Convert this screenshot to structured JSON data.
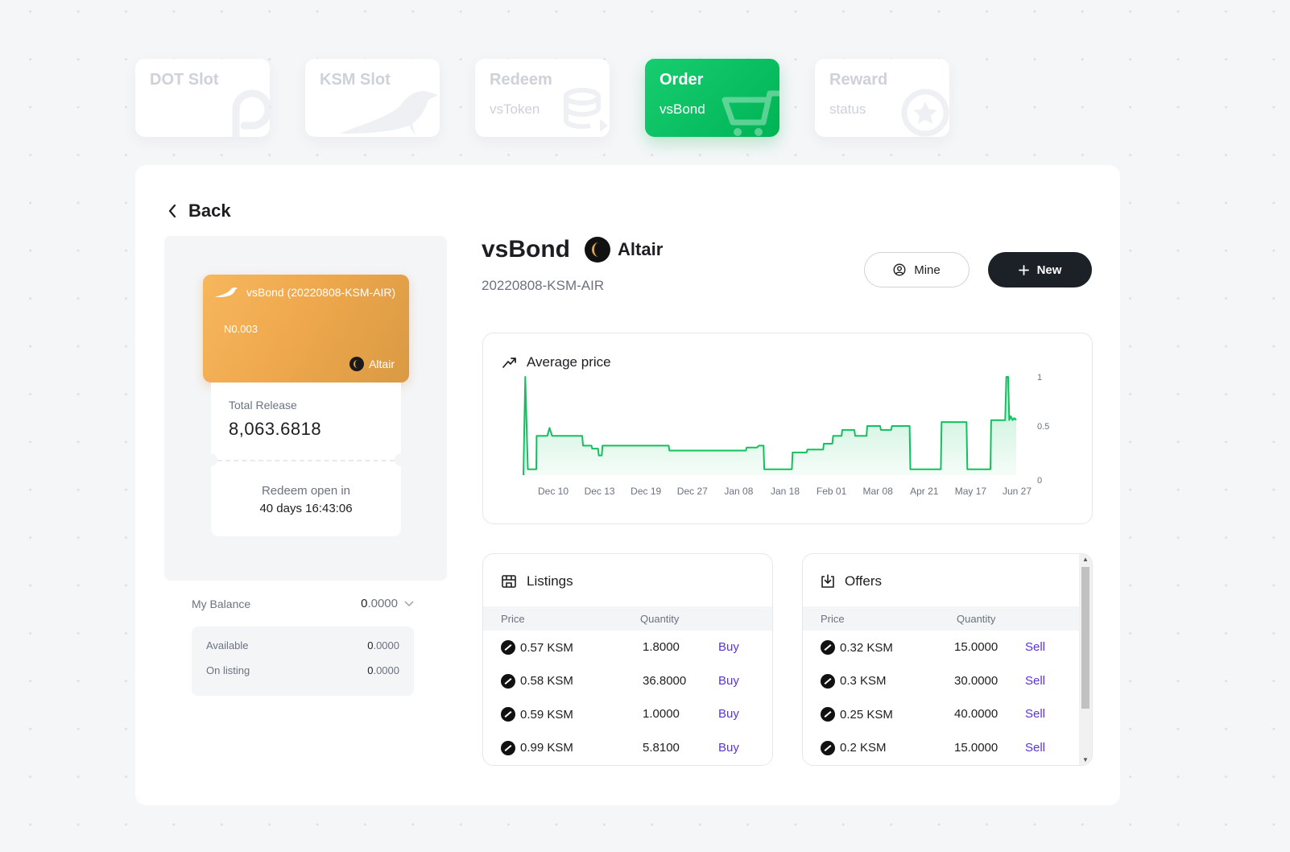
{
  "tabs": [
    {
      "title": "DOT Slot",
      "subtitle": "",
      "icon": "polkadot-icon",
      "active": false
    },
    {
      "title": "KSM Slot",
      "subtitle": "",
      "icon": "kusama-bird-icon",
      "active": false
    },
    {
      "title": "Redeem",
      "subtitle": "vsToken",
      "icon": "coin-stack-icon",
      "active": false
    },
    {
      "title": "Order",
      "subtitle": "vsBond",
      "icon": "cart-icon",
      "active": true
    },
    {
      "title": "Reward",
      "subtitle": "status",
      "icon": "star-badge-icon",
      "active": false
    }
  ],
  "back_label": "Back",
  "bond_card": {
    "name": "vsBond (20220808-KSM-AIR)",
    "number": "N0.003",
    "issuer": "Altair"
  },
  "release": {
    "label": "Total Release",
    "value": "8,063.6818",
    "redeem_label": "Redeem open in",
    "redeem_time": "40 days 16:43:06"
  },
  "balance": {
    "label": "My Balance",
    "value_int": "0",
    "value_dec": ".0000",
    "available_label": "Available",
    "available_int": "0",
    "available_dec": ".0000",
    "listing_label": "On listing",
    "listing_int": "0",
    "listing_dec": ".0000"
  },
  "header": {
    "title": "vsBond",
    "issuer": "Altair",
    "subtitle": "20220808-KSM-AIR",
    "mine_label": "Mine",
    "new_label": "New"
  },
  "chart_data": {
    "type": "line",
    "title": "Average price",
    "x_ticks": [
      "Dec 10",
      "Dec 13",
      "Dec 19",
      "Dec 27",
      "Jan 08",
      "Jan 18",
      "Feb 01",
      "Mar 08",
      "Apr 21",
      "May 17",
      "Jun 27"
    ],
    "y_ticks": [
      "1",
      "0.5",
      "0"
    ],
    "ylim": [
      0,
      1
    ],
    "series_color": "#10c25f",
    "fill": "area-gradient",
    "points": [
      [
        0,
        0.0
      ],
      [
        0.5,
        1.0
      ],
      [
        1.2,
        0.06
      ],
      [
        3.5,
        0.06
      ],
      [
        3.6,
        0.4
      ],
      [
        6.5,
        0.4
      ],
      [
        7.1,
        0.48
      ],
      [
        7.8,
        0.4
      ],
      [
        16,
        0.4
      ],
      [
        16.2,
        0.3
      ],
      [
        18.5,
        0.3
      ],
      [
        18.7,
        0.27
      ],
      [
        20.3,
        0.27
      ],
      [
        20.5,
        0.2
      ],
      [
        21.3,
        0.2
      ],
      [
        21.5,
        0.3
      ],
      [
        39.5,
        0.3
      ],
      [
        39.7,
        0.25
      ],
      [
        60.5,
        0.25
      ],
      [
        60.7,
        0.28
      ],
      [
        63.5,
        0.28
      ],
      [
        64,
        0.3
      ],
      [
        65.3,
        0.3
      ],
      [
        65.5,
        0.06
      ],
      [
        73,
        0.06
      ],
      [
        73.2,
        0.23
      ],
      [
        77,
        0.23
      ],
      [
        77.2,
        0.26
      ],
      [
        81.5,
        0.26
      ],
      [
        81.7,
        0.32
      ],
      [
        84,
        0.32
      ],
      [
        84.2,
        0.4
      ],
      [
        86.5,
        0.4
      ],
      [
        86.7,
        0.46
      ],
      [
        90,
        0.46
      ],
      [
        90.2,
        0.4
      ],
      [
        93.3,
        0.4
      ],
      [
        93.5,
        0.5
      ],
      [
        97,
        0.5
      ],
      [
        97.2,
        0.46
      ],
      [
        100,
        0.46
      ],
      [
        100.2,
        0.5
      ],
      [
        105,
        0.5
      ],
      [
        105.2,
        0.06
      ],
      [
        113.5,
        0.06
      ],
      [
        113.7,
        0.54
      ],
      [
        120.5,
        0.54
      ],
      [
        120.7,
        0.06
      ],
      [
        127,
        0.06
      ],
      [
        127.2,
        0.56
      ],
      [
        131,
        0.56
      ],
      [
        131.3,
        1.0
      ],
      [
        131.8,
        1.0
      ],
      [
        132.1,
        0.56
      ],
      [
        132.5,
        0.6
      ],
      [
        133,
        0.56
      ],
      [
        133.5,
        0.58
      ],
      [
        134,
        0.56
      ]
    ],
    "x_range": [
      0,
      134
    ]
  },
  "listings": {
    "title": "Listings",
    "col_price": "Price",
    "col_qty": "Quantity",
    "rows": [
      {
        "price": "0.57 KSM",
        "qty": "1.8000",
        "action": "Buy"
      },
      {
        "price": "0.58 KSM",
        "qty": "36.8000",
        "action": "Buy"
      },
      {
        "price": "0.59 KSM",
        "qty": "1.0000",
        "action": "Buy"
      },
      {
        "price": "0.99 KSM",
        "qty": "5.8100",
        "action": "Buy"
      }
    ]
  },
  "offers": {
    "title": "Offers",
    "col_price": "Price",
    "col_qty": "Quantity",
    "rows": [
      {
        "price": "0.32 KSM",
        "qty": "15.0000",
        "action": "Sell"
      },
      {
        "price": "0.3 KSM",
        "qty": "30.0000",
        "action": "Sell"
      },
      {
        "price": "0.25 KSM",
        "qty": "40.0000",
        "action": "Sell"
      },
      {
        "price": "0.2 KSM",
        "qty": "15.0000",
        "action": "Sell"
      }
    ]
  }
}
